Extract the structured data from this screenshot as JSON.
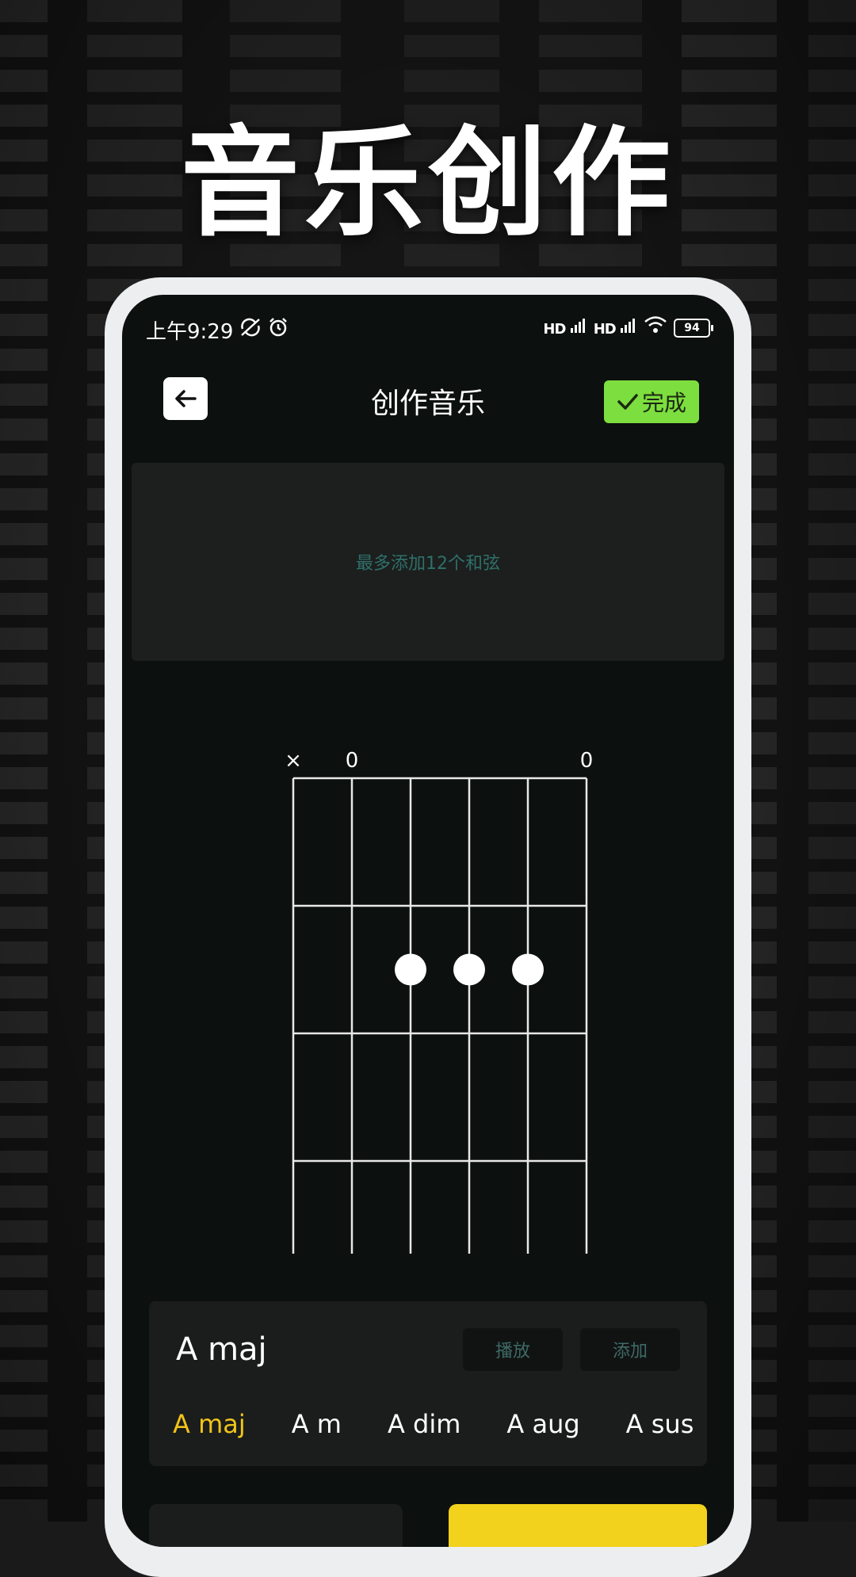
{
  "hero": {
    "title": "音乐创作"
  },
  "status_bar": {
    "time": "上午9:29",
    "icons": [
      "sync-off-icon",
      "alarm-icon"
    ],
    "signal_label": "HD",
    "battery": "94"
  },
  "header": {
    "back_icon": "arrow-left-icon",
    "title": "创作音乐",
    "done_label": "完成",
    "done_icon": "check-icon"
  },
  "chord_slots": {
    "hint": "最多添加12个和弦"
  },
  "chord_diagram": {
    "string_markers": [
      "×",
      "0",
      "",
      "",
      "",
      "0"
    ],
    "frets": 4,
    "strings": 6,
    "dots": [
      {
        "string": 3,
        "fret": 2
      },
      {
        "string": 4,
        "fret": 2
      },
      {
        "string": 5,
        "fret": 2
      }
    ]
  },
  "chord_card": {
    "name": "A maj",
    "play_label": "播放",
    "add_label": "添加",
    "types": [
      "A maj",
      "A m",
      "A dim",
      "A aug",
      "A sus"
    ],
    "selected_type": "A maj"
  },
  "colors": {
    "accent_green": "#7dde3f",
    "accent_yellow": "#f2d21c",
    "selected_text": "#f0c419",
    "hint_text": "#2f6f6b"
  }
}
